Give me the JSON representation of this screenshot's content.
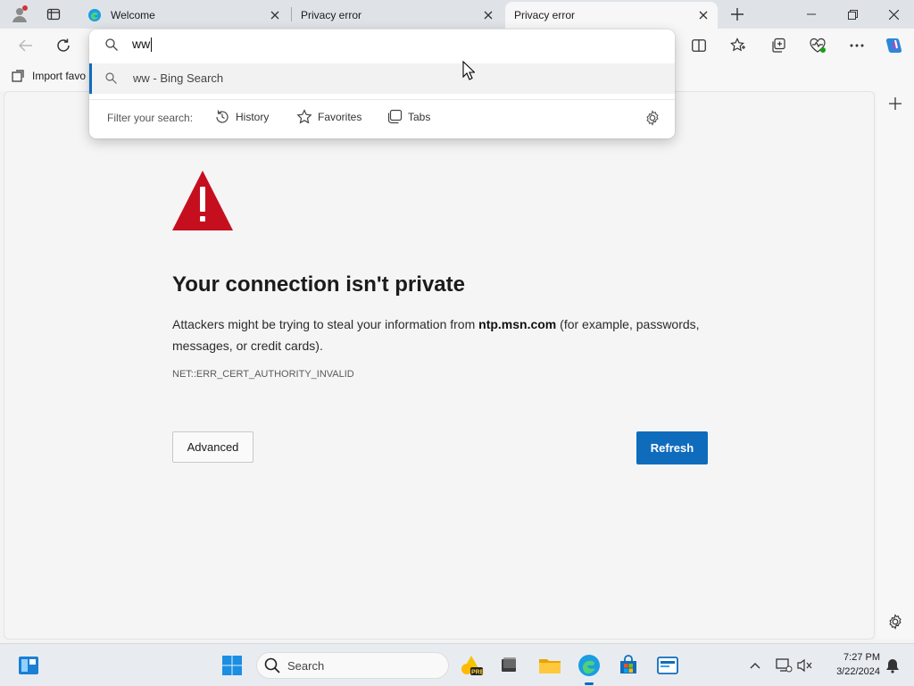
{
  "tabs": [
    {
      "title": "Welcome",
      "icon": "edge-icon"
    },
    {
      "title": "Privacy error",
      "icon": "none"
    },
    {
      "title": "Privacy error",
      "icon": "none"
    }
  ],
  "favorites_bar": {
    "import_label": "Import favo"
  },
  "address_dropdown": {
    "typed_text": "ww",
    "suggestion": "ww - Bing Search",
    "filter_label": "Filter your search:",
    "filters": [
      {
        "label": "History",
        "icon": "history-icon"
      },
      {
        "label": "Favorites",
        "icon": "star-icon"
      },
      {
        "label": "Tabs",
        "icon": "tabs-icon"
      }
    ]
  },
  "error_page": {
    "heading": "Your connection isn't private",
    "desc_before": "Attackers might be trying to steal your information from ",
    "desc_host": "ntp.msn.com",
    "desc_after": " (for example, passwords, messages, or credit cards).",
    "error_code": "NET::ERR_CERT_AUTHORITY_INVALID",
    "advanced_label": "Advanced",
    "refresh_label": "Refresh"
  },
  "taskbar": {
    "search_label": "Search",
    "time": "7:27 PM",
    "date": "3/22/2024"
  },
  "colors": {
    "accent": "#0f6cbd",
    "warning_red": "#c50f1f"
  }
}
